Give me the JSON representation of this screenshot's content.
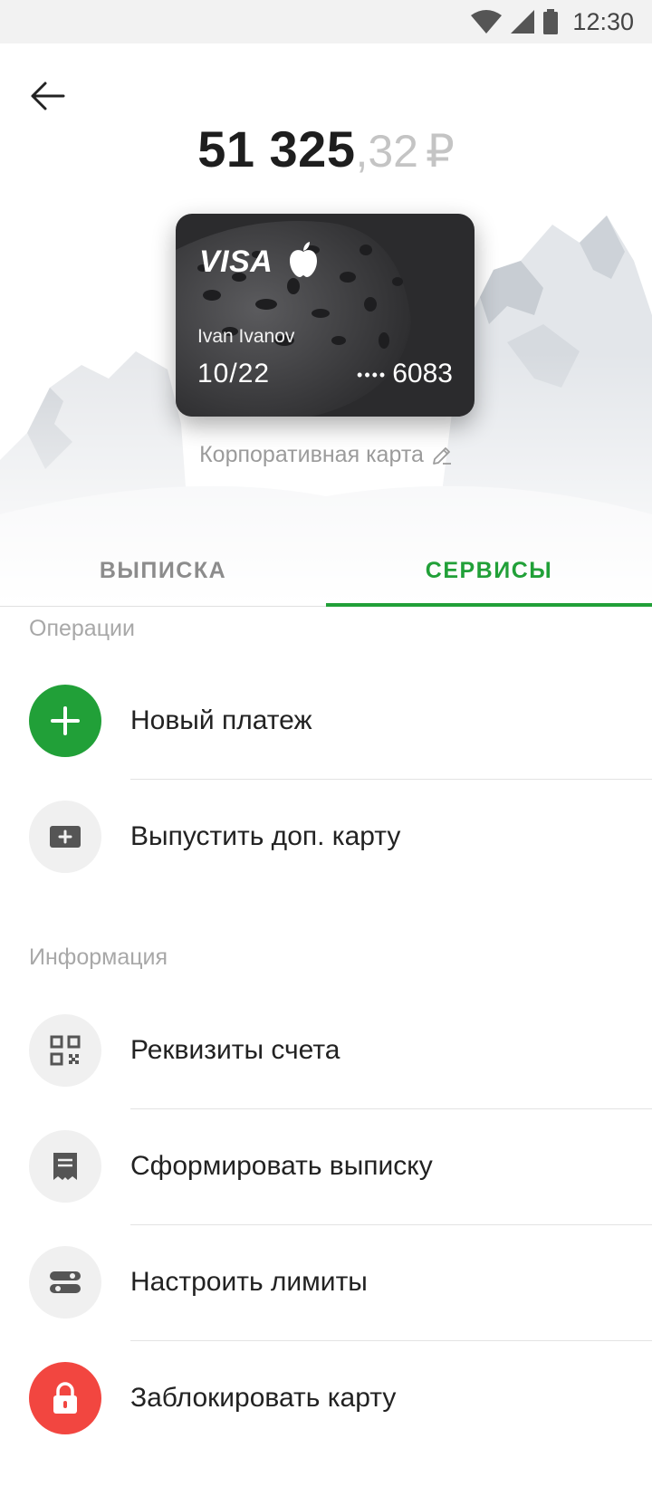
{
  "status_bar": {
    "time": "12:30"
  },
  "balance": {
    "integer": "51 325",
    "fraction": ",32",
    "currency": "₽"
  },
  "card": {
    "brand": "VISA",
    "holder": "Ivan Ivanov",
    "expiry": "10/22",
    "masked_dots": "••••",
    "last_digits": "6083",
    "caption": "Корпоративная карта"
  },
  "tabs": [
    {
      "label": "ВЫПИСКА",
      "active": false
    },
    {
      "label": "СЕРВИСЫ",
      "active": true
    }
  ],
  "sections": {
    "operations": {
      "title": "Операции",
      "items": [
        {
          "label": "Новый платеж",
          "icon": "plus-icon"
        },
        {
          "label": "Выпустить доп. карту",
          "icon": "add-card-icon"
        }
      ]
    },
    "info": {
      "title": "Информация",
      "items": [
        {
          "label": "Реквизиты счета",
          "icon": "qr-code-icon"
        },
        {
          "label": "Сформировать выписку",
          "icon": "receipt-icon"
        },
        {
          "label": "Настроить лимиты",
          "icon": "limits-icon"
        },
        {
          "label": "Заблокировать карту",
          "icon": "lock-icon"
        }
      ]
    }
  },
  "colors": {
    "accent": "#21a038",
    "danger": "#f24640",
    "muted": "#a8a8a8"
  }
}
